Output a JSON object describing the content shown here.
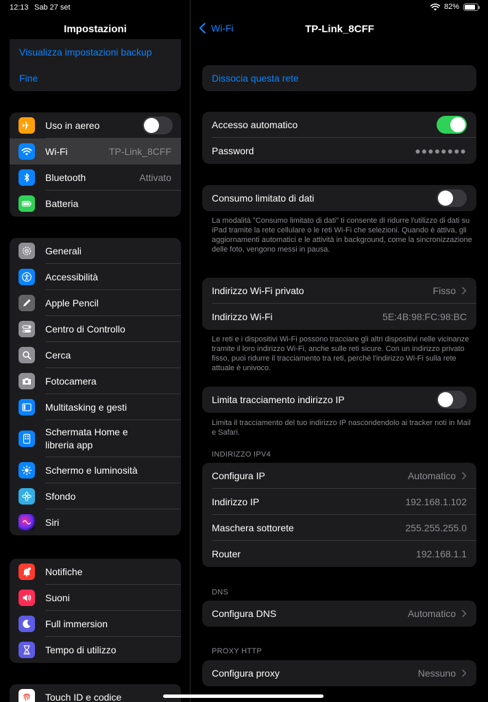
{
  "status": {
    "time": "12:13",
    "date": "Sab 27 set",
    "battery": "82%"
  },
  "sidebar": {
    "title": "Impostazioni",
    "top_links": [
      "Visualizza impostazioni backup",
      "Fine"
    ],
    "connectivity": {
      "airplane": "Uso in aereo",
      "wifi": "Wi-Fi",
      "wifi_value": "TP-Link_8CFF",
      "bluetooth": "Bluetooth",
      "bluetooth_value": "Attivato",
      "battery": "Batteria"
    },
    "general": [
      "Generali",
      "Accessibilità",
      "Apple Pencil",
      "Centro di Controllo",
      "Cerca",
      "Fotocamera",
      "Multitasking e gesti",
      "Schermata Home e\nlibreria app",
      "Schermo e luminosità",
      "Sfondo",
      "Siri"
    ],
    "notifications": [
      "Notifiche",
      "Suoni",
      "Full immersion",
      "Tempo di utilizzo"
    ],
    "touchid": "Touch ID e codice"
  },
  "detail": {
    "back_label": "Wi-Fi",
    "title": "TP-Link_8CFF",
    "forget": "Dissocia questa rete",
    "auto_join": "Accesso automatico",
    "password": "Password",
    "password_mask": "●●●●●●●●",
    "low_data": "Consumo limitato di dati",
    "low_data_note": "La modalità \"Consumo limitato di dati\" ti consente di ridurre l'utilizzo di dati su iPad tramite la rete cellulare o le reti Wi-Fi che selezioni. Quando è attiva, gli aggiornamenti automatici e le attività in background, come la sincronizzazione delle foto, vengono messi in pausa.",
    "private_addr": "Indirizzo Wi-Fi privato",
    "private_addr_value": "Fisso",
    "wifi_addr": "Indirizzo Wi-Fi",
    "wifi_addr_value": "5E:4B:98:FC:98:BC",
    "private_note": "Le reti e i dispositivi Wi-Fi possono tracciare gli altri dispositivi nelle vicinanze tramite il loro indirizzo Wi-Fi, anche sulle reti sicure. Con un indirizzo privato fisso, puoi ridurre il tracciamento tra reti, perché l'indirizzo Wi-Fi sulla rete attuale è univoco.",
    "limit_ip": "Limita tracciamento indirizzo IP",
    "limit_ip_note": "Limita il tracciamento del tuo indirizzo IP nascondendolo ai tracker noti in Mail e Safari.",
    "ipv4_header": "INDIRIZZO IPV4",
    "configure_ip": "Configura IP",
    "configure_ip_value": "Automatico",
    "ip_address": "Indirizzo IP",
    "ip_address_value": "192.168.1.102",
    "subnet": "Maschera sottorete",
    "subnet_value": "255.255.255.0",
    "router": "Router",
    "router_value": "192.168.1.1",
    "dns_header": "DNS",
    "configure_dns": "Configura DNS",
    "configure_dns_value": "Automatico",
    "proxy_header": "PROXY HTTP",
    "configure_proxy": "Configura proxy",
    "configure_proxy_value": "Nessuno"
  },
  "colors": {
    "accent": "#0a84ff",
    "toggle_on": "#30d158",
    "group_bg": "#1c1c1e",
    "secondary_text": "#8e8e93"
  }
}
